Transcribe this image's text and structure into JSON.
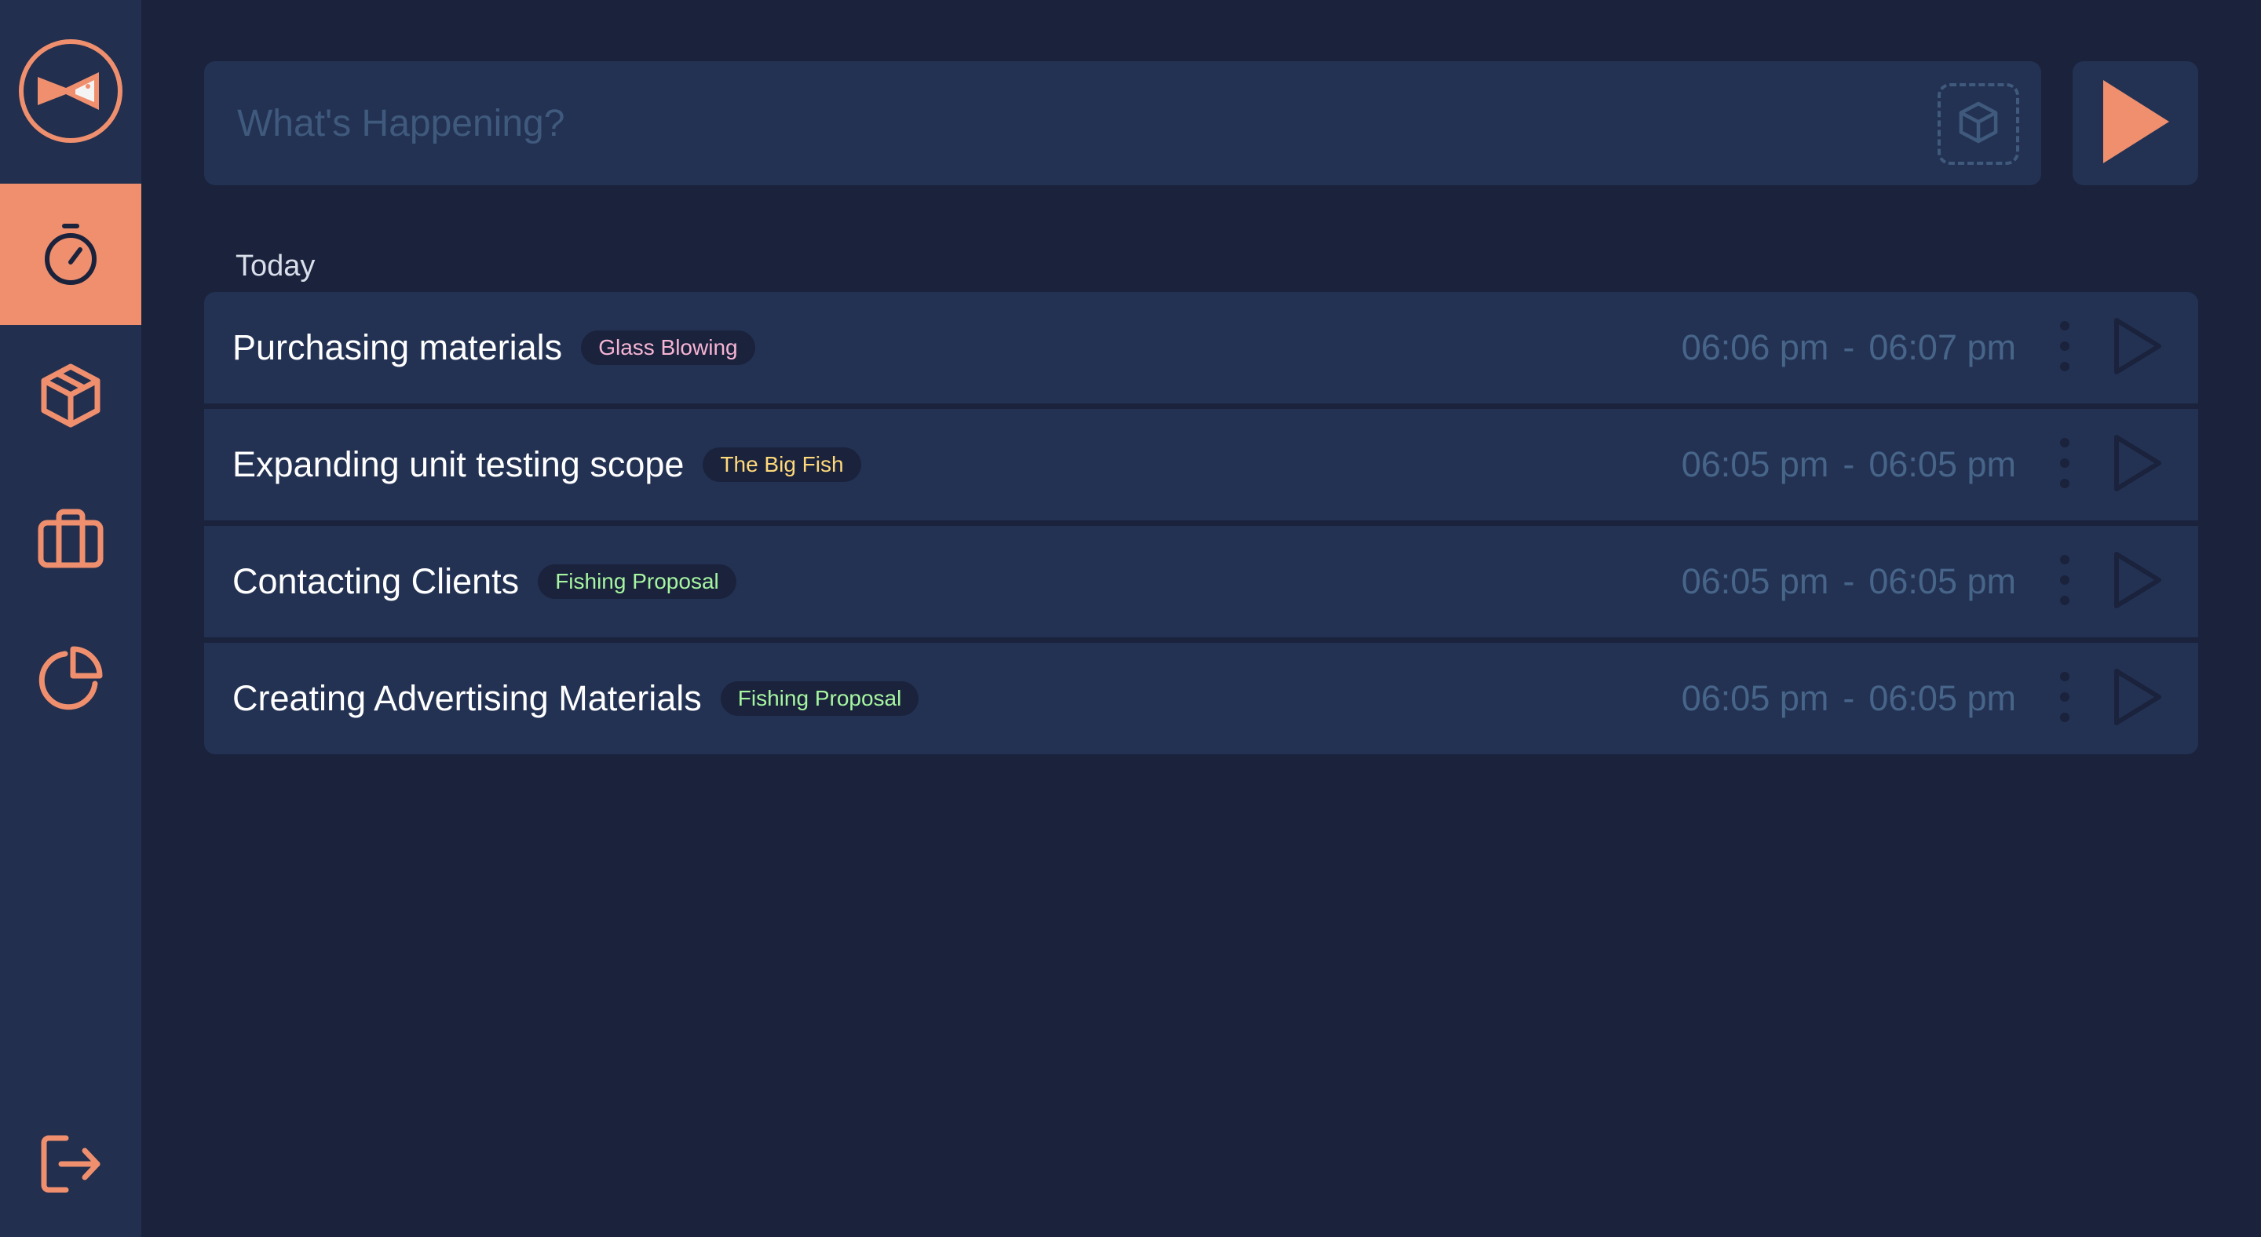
{
  "sidebar": {
    "logo": "fish-logo",
    "items": [
      {
        "id": "timer",
        "icon": "stopwatch-icon",
        "active": true
      },
      {
        "id": "projects",
        "icon": "cube-icon",
        "active": false
      },
      {
        "id": "clients",
        "icon": "briefcase-icon",
        "active": false
      },
      {
        "id": "reports",
        "icon": "pie-chart-icon",
        "active": false
      }
    ],
    "logout_icon": "logout-icon"
  },
  "entry": {
    "placeholder": "What's Happening?",
    "value": "",
    "project_icon": "cube-icon",
    "start_icon": "play-icon"
  },
  "day": {
    "label": "Today",
    "entries": [
      {
        "description": "Purchasing materials",
        "project": "Glass Blowing",
        "project_color": "#f7b4d4",
        "start": "06:06 pm",
        "separator": "-",
        "end": "06:07 pm"
      },
      {
        "description": "Expanding unit testing scope",
        "project": "The Big Fish",
        "project_color": "#ffd97a",
        "start": "06:05 pm",
        "separator": "-",
        "end": "06:05 pm"
      },
      {
        "description": "Contacting Clients",
        "project": "Fishing Proposal",
        "project_color": "#a6f5a0",
        "start": "06:05 pm",
        "separator": "-",
        "end": "06:05 pm"
      },
      {
        "description": "Creating Advertising Materials",
        "project": "Fishing Proposal",
        "project_color": "#a6f5a0",
        "start": "06:05 pm",
        "separator": "-",
        "end": "06:05 pm"
      }
    ]
  },
  "colors": {
    "accent": "#ef8f6e",
    "background": "#1a223c",
    "panel": "#233253",
    "muted": "#476489"
  }
}
